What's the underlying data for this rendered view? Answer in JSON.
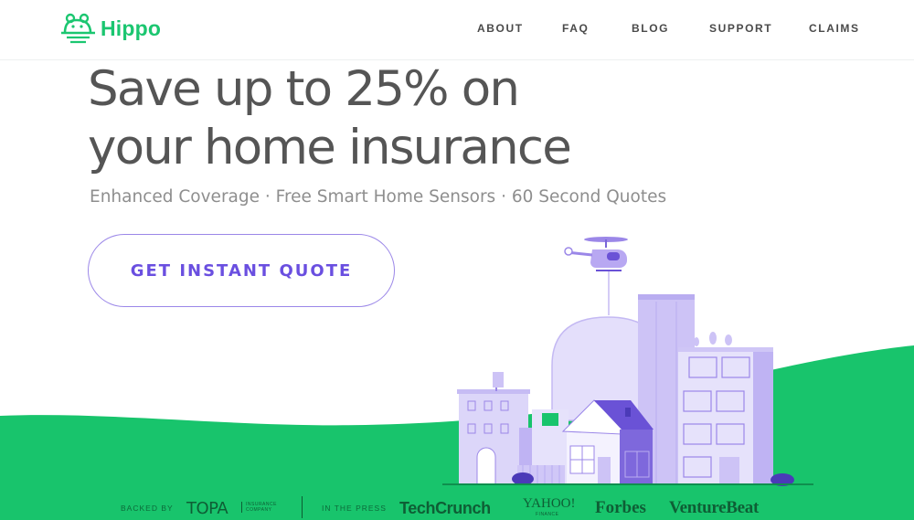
{
  "brand": {
    "name": "Hippo",
    "logo_icon": "hippo-icon",
    "accent": "#1bc670"
  },
  "nav": {
    "items": [
      "ABOUT",
      "FAQ",
      "BLOG",
      "SUPPORT",
      "CLAIMS"
    ]
  },
  "hero": {
    "headline_line1": "Save up to 25% on",
    "headline_line2": "your home insurance",
    "subhead": "Enhanced Coverage · Free Smart Home Sensors · 60 Second Quotes",
    "cta_label": "GET INSTANT QUOTE"
  },
  "press": {
    "backed_by_label": "BACKED BY",
    "backer_name": "TOPA",
    "backer_tagline_1": "INSURANCE",
    "backer_tagline_2": "COMPANY",
    "in_press_label": "IN THE PRESS",
    "outlets": [
      "TechCrunch",
      "YAHOO!",
      "Forbes",
      "VentureBeat"
    ],
    "yahoo_sub": "FINANCE"
  },
  "colors": {
    "ground": "#18c46c",
    "building_light": "#d9d3f8",
    "building_mid": "#b9adf0",
    "building_dark": "#6a52d6",
    "cta_text": "#6a4fe0",
    "headline": "#555555"
  }
}
